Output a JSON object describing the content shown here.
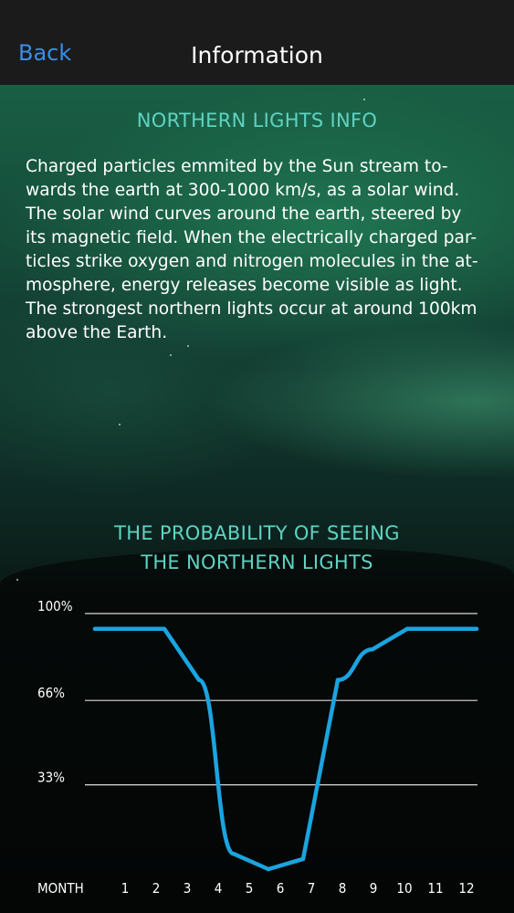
{
  "nav": {
    "back_label": "Back",
    "title": "Information"
  },
  "info": {
    "title": "NORTHERN LIGHTS INFO",
    "lines": [
      "Charged particles emmited by the Sun stream to-",
      "wards the earth at 300-1000 km/s, as a solar wind.",
      "The solar wind curves around the earth, steered by",
      "its magnetic field. When the electrically charged par-",
      "ticles strike oxygen and nitrogen molecules in the at-",
      "mosphere, energy releases become visible as light.",
      "The strongest northern lights occur at around 100km",
      "above the Earth."
    ]
  },
  "chart_title": {
    "line1": "THE PROBABILITY OF SEEING",
    "line2": "THE NORTHERN LIGHTS"
  },
  "chart_data": {
    "type": "line",
    "title": "THE PROBABILITY OF SEEING THE NORTHERN LIGHTS",
    "xlabel": "MONTH",
    "ylabel": "",
    "x": [
      1,
      2,
      3,
      4,
      5,
      6,
      7,
      8,
      9,
      10,
      11,
      12
    ],
    "categories": [
      "1",
      "2",
      "3",
      "4",
      "5",
      "6",
      "7",
      "8",
      "9",
      "10",
      "11",
      "12"
    ],
    "y_ticks": [
      "100%",
      "66%",
      "33%"
    ],
    "y_tick_values": [
      100,
      66,
      33
    ],
    "ylim": [
      0,
      100
    ],
    "grid": true,
    "series": [
      {
        "values": [
          94,
          94,
          94,
          74,
          6,
          0,
          4,
          74,
          86,
          94,
          94,
          94
        ]
      }
    ],
    "colors": {
      "line": "#1aa4e0",
      "grid": "#d9d9d9",
      "text": "#ffffff"
    }
  }
}
